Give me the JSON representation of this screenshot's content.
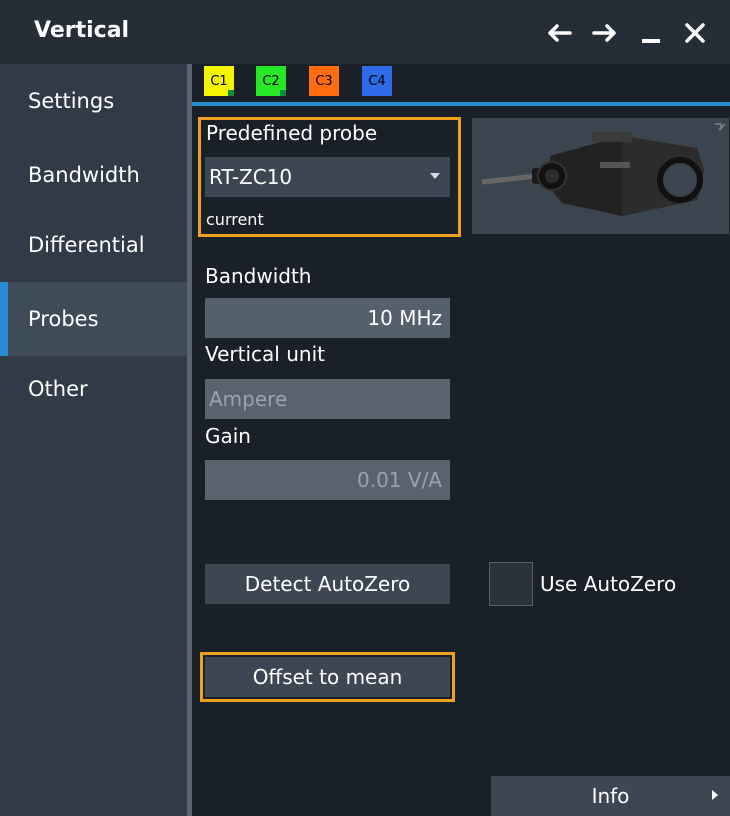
{
  "window": {
    "title": "Vertical"
  },
  "titlebar_icons": [
    "arrow-left-icon",
    "arrow-right-icon",
    "minimize-icon",
    "close-icon"
  ],
  "sidebar": {
    "items": [
      {
        "label": "Settings",
        "active": false
      },
      {
        "label": "Bandwidth",
        "active": false
      },
      {
        "label": "Differential",
        "active": false
      },
      {
        "label": "Probes",
        "active": true
      },
      {
        "label": "Other",
        "active": false
      }
    ]
  },
  "tabs": [
    {
      "label": "C1",
      "color": "#f5f500",
      "active": true
    },
    {
      "label": "C2",
      "color": "#26e826",
      "active": false
    },
    {
      "label": "C3",
      "color": "#ff6b0f",
      "active": false
    },
    {
      "label": "C4",
      "color": "#2f6be8",
      "active": false
    }
  ],
  "colors": {
    "accent": "#2a8ad4",
    "highlight": "#f0a020"
  },
  "probe": {
    "predefined_label": "Predefined probe",
    "predefined_value": "RT-ZC10",
    "type_text": "current"
  },
  "bandwidth": {
    "label": "Bandwidth",
    "value": "10 MHz"
  },
  "vertical_unit": {
    "label": "Vertical unit",
    "value": "Ampere"
  },
  "gain": {
    "label": "Gain",
    "value": "0.01 V/A"
  },
  "buttons": {
    "detect_autozero": "Detect AutoZero",
    "use_autozero": "Use AutoZero",
    "offset_to_mean": "Offset to mean",
    "info": "Info"
  }
}
